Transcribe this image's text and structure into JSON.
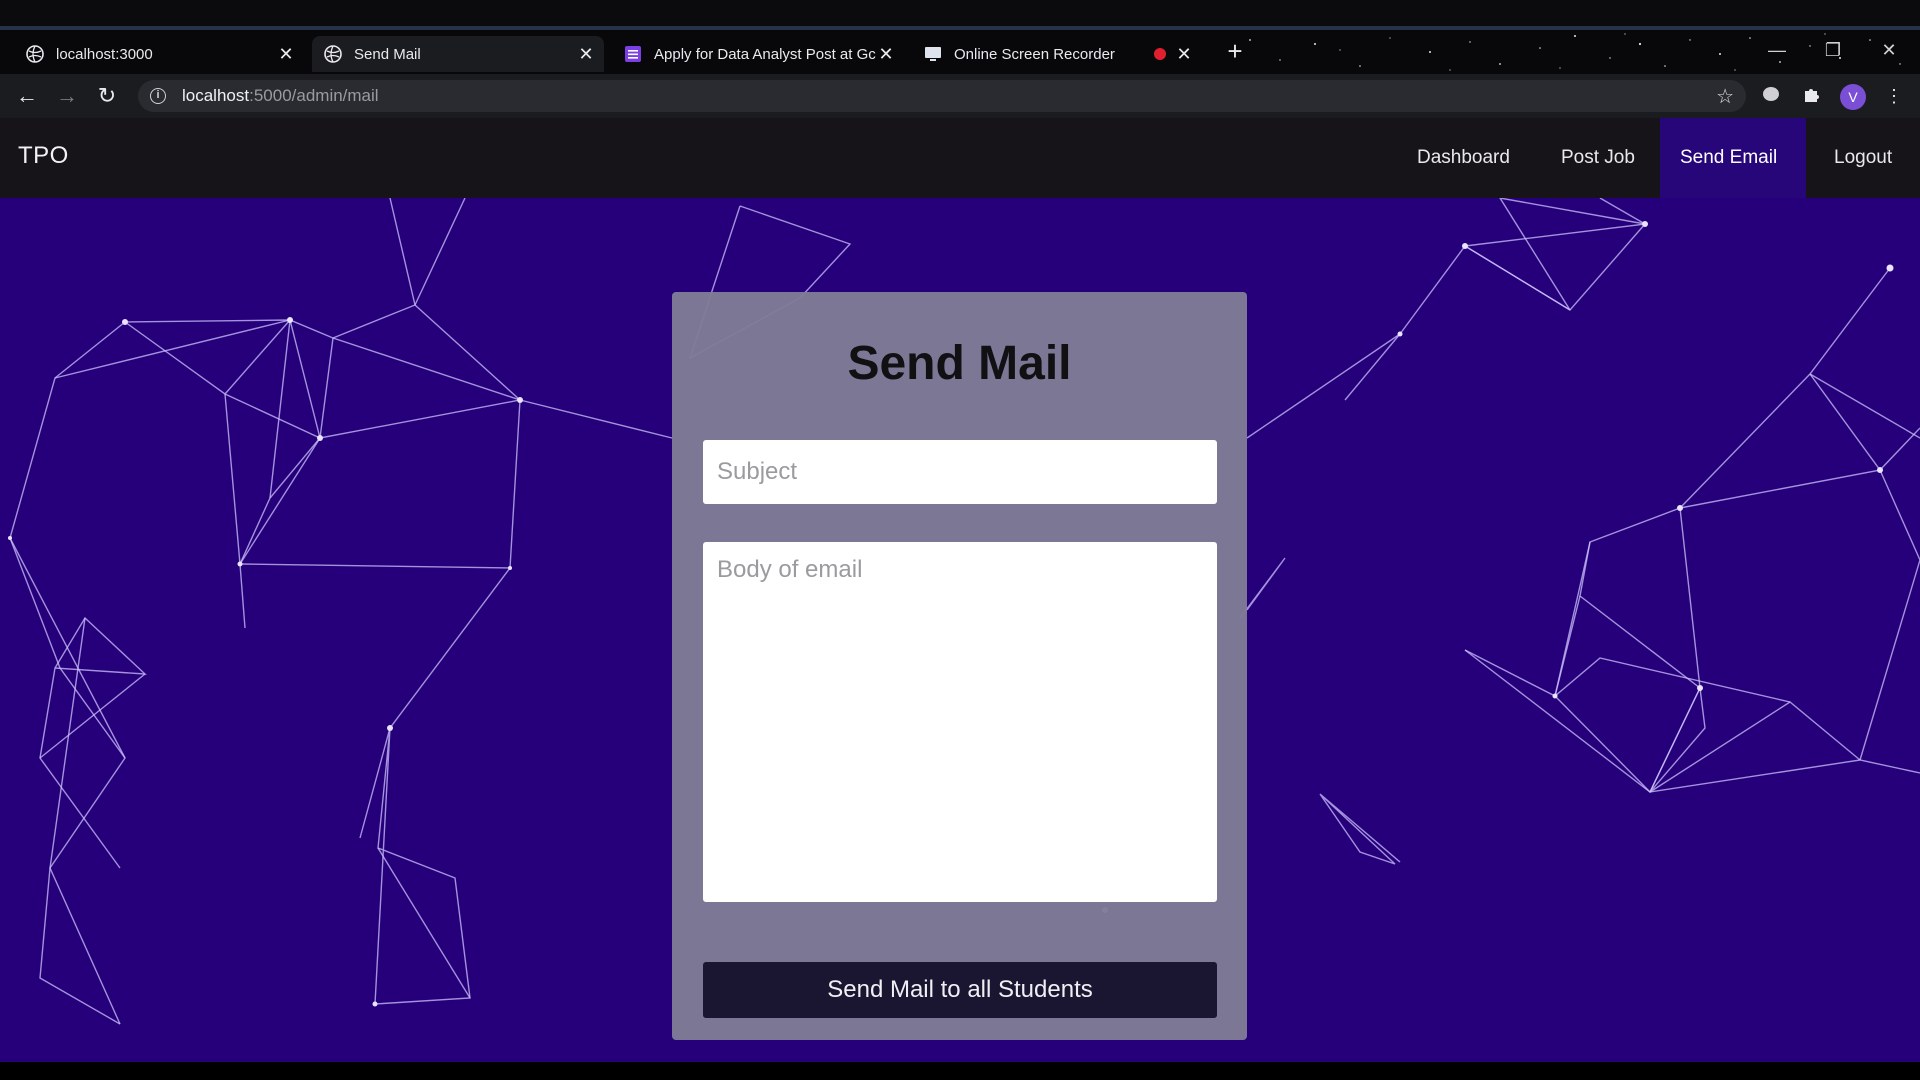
{
  "browser": {
    "tabs": [
      {
        "title": "localhost:3000",
        "icon": "globe-icon"
      },
      {
        "title": "Send Mail",
        "icon": "globe-icon"
      },
      {
        "title": "Apply for Data Analyst Post at Gc",
        "icon": "form-icon"
      },
      {
        "title": "Online Screen Recorder",
        "icon": "monitor-icon"
      }
    ],
    "active_tab_index": 1,
    "url_host": "localhost",
    "url_path": ":5000/admin/mail",
    "profile_initial": "V"
  },
  "app": {
    "brand": "TPO",
    "nav": [
      {
        "label": "Dashboard"
      },
      {
        "label": "Post Job"
      },
      {
        "label": "Send Email"
      },
      {
        "label": "Logout"
      }
    ],
    "active_nav_index": 2
  },
  "form": {
    "title": "Send Mail",
    "subject_placeholder": "Subject",
    "subject_value": "",
    "body_placeholder": "Body of email",
    "body_value": "",
    "submit_label": "Send Mail to all Students"
  },
  "colors": {
    "page_background": "#26007a",
    "navbar_background": "#161418",
    "active_nav": "#27067a",
    "card_background": "#807c96",
    "button_background": "#1a1530",
    "recording_dot": "#e0202e"
  }
}
